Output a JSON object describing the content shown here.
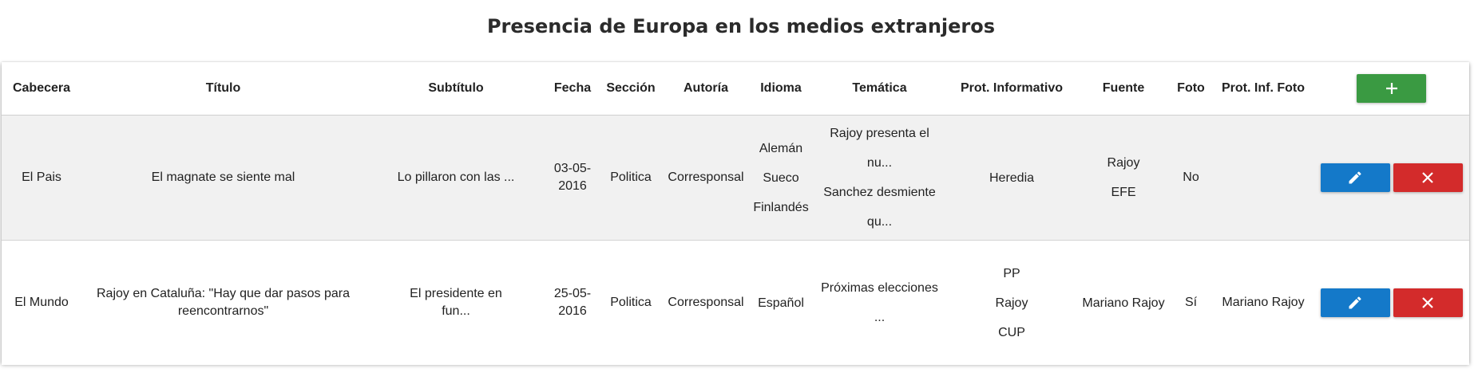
{
  "page": {
    "title": "Presencia de Europa en los medios extranjeros"
  },
  "columns": [
    "Cabecera",
    "Título",
    "Subtítulo",
    "Fecha",
    "Sección",
    "Autoría",
    "Idioma",
    "Temática",
    "Prot. Informativo",
    "Fuente",
    "Foto",
    "Prot. Inf. Foto"
  ],
  "rows": [
    {
      "cabecera": "El Pais",
      "titulo_1": "El magnate se siente mal",
      "titulo_2": "",
      "subtitulo_1": "Lo pillaron con las ...",
      "subtitulo_2": "",
      "fecha_1": "03-05-",
      "fecha_2": "2016",
      "seccion": "Politica",
      "autoria": "Corresponsal",
      "idioma": [
        "Alemán",
        "Sueco",
        "Finlandés"
      ],
      "tematica": [
        "Rajoy presenta el nu...",
        "Sanchez desmiente qu..."
      ],
      "prot_informativo": [
        "Heredia"
      ],
      "fuente": [
        "Rajoy",
        "EFE"
      ],
      "foto": "No",
      "prot_inf_foto": ""
    },
    {
      "cabecera": "El Mundo",
      "titulo_1": "Rajoy en Cataluña: \"Hay que dar pasos para",
      "titulo_2": "reencontrarnos\"",
      "subtitulo_1": "El presidente en",
      "subtitulo_2": "fun...",
      "fecha_1": "25-05-",
      "fecha_2": "2016",
      "seccion": "Politica",
      "autoria": "Corresponsal",
      "idioma": [
        "Español"
      ],
      "tematica": [
        "Próximas elecciones ..."
      ],
      "prot_informativo": [
        "PP",
        "Rajoy",
        "CUP"
      ],
      "fuente": [
        "Mariano Rajoy"
      ],
      "foto": "Sí",
      "prot_inf_foto": "Mariano Rajoy"
    }
  ],
  "icons": {
    "add": "plus-icon",
    "edit": "pencil-icon",
    "delete": "close-icon"
  },
  "colors": {
    "add_button": "#3a9a42",
    "edit_button": "#1479c9",
    "delete_button": "#d32b2b",
    "row_alt_background": "#f1f1f1"
  }
}
